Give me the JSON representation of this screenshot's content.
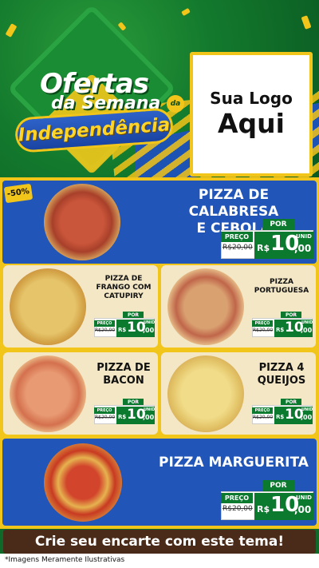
{
  "header": {
    "title_line1": "Ofertas",
    "title_line2": "da Semana",
    "title_de": "da",
    "title_ribbon": "Independência",
    "logo_line1": "Sua Logo",
    "logo_line2": "Aqui"
  },
  "discount_badge": "-50%",
  "products": [
    {
      "name_lines": [
        "PIZZA DE CALABRESA",
        "E CEBOLA"
      ],
      "por": "POR",
      "preco": "PREÇO",
      "old_price": "R$20,00",
      "currency": "R$",
      "price_int": "10",
      "price_dec": ",00",
      "unit": "UNID"
    },
    {
      "name_lines": [
        "PIZZA DE",
        "FRANGO COM",
        "CATUPIRY"
      ],
      "por": "POR",
      "preco": "PREÇO",
      "old_price": "R$20,00",
      "currency": "R$",
      "price_int": "10",
      "price_dec": ",00",
      "unit": "UNID"
    },
    {
      "name_lines": [
        "PIZZA",
        "PORTUGUESA"
      ],
      "por": "POR",
      "preco": "PREÇO",
      "old_price": "R$20,00",
      "currency": "R$",
      "price_int": "10",
      "price_dec": ",00",
      "unit": "UNID"
    },
    {
      "name_lines": [
        "PIZZA DE",
        "BACON"
      ],
      "por": "POR",
      "preco": "PREÇO",
      "old_price": "R$20,00",
      "currency": "R$",
      "price_int": "10",
      "price_dec": ",00",
      "unit": "UNID"
    },
    {
      "name_lines": [
        "PIZZA 4",
        "QUEIJOS"
      ],
      "por": "POR",
      "preco": "PREÇO",
      "old_price": "R$20,00",
      "currency": "R$",
      "price_int": "10",
      "price_dec": ",00",
      "unit": "UNID"
    },
    {
      "name_lines": [
        "PIZZA MARGUERITA"
      ],
      "por": "POR",
      "preco": "PREÇO",
      "old_price": "R$20,00",
      "currency": "R$",
      "price_int": "10",
      "price_dec": ",00",
      "unit": "UNID"
    }
  ],
  "cta": "Crie seu encarte com este tema!",
  "footnote": "*Imagens Meramente Ilustrativas",
  "colors": {
    "green": "#0b7a2e",
    "blue": "#2155b8",
    "yellow": "#f2c51a",
    "brown": "#4a2a18"
  }
}
